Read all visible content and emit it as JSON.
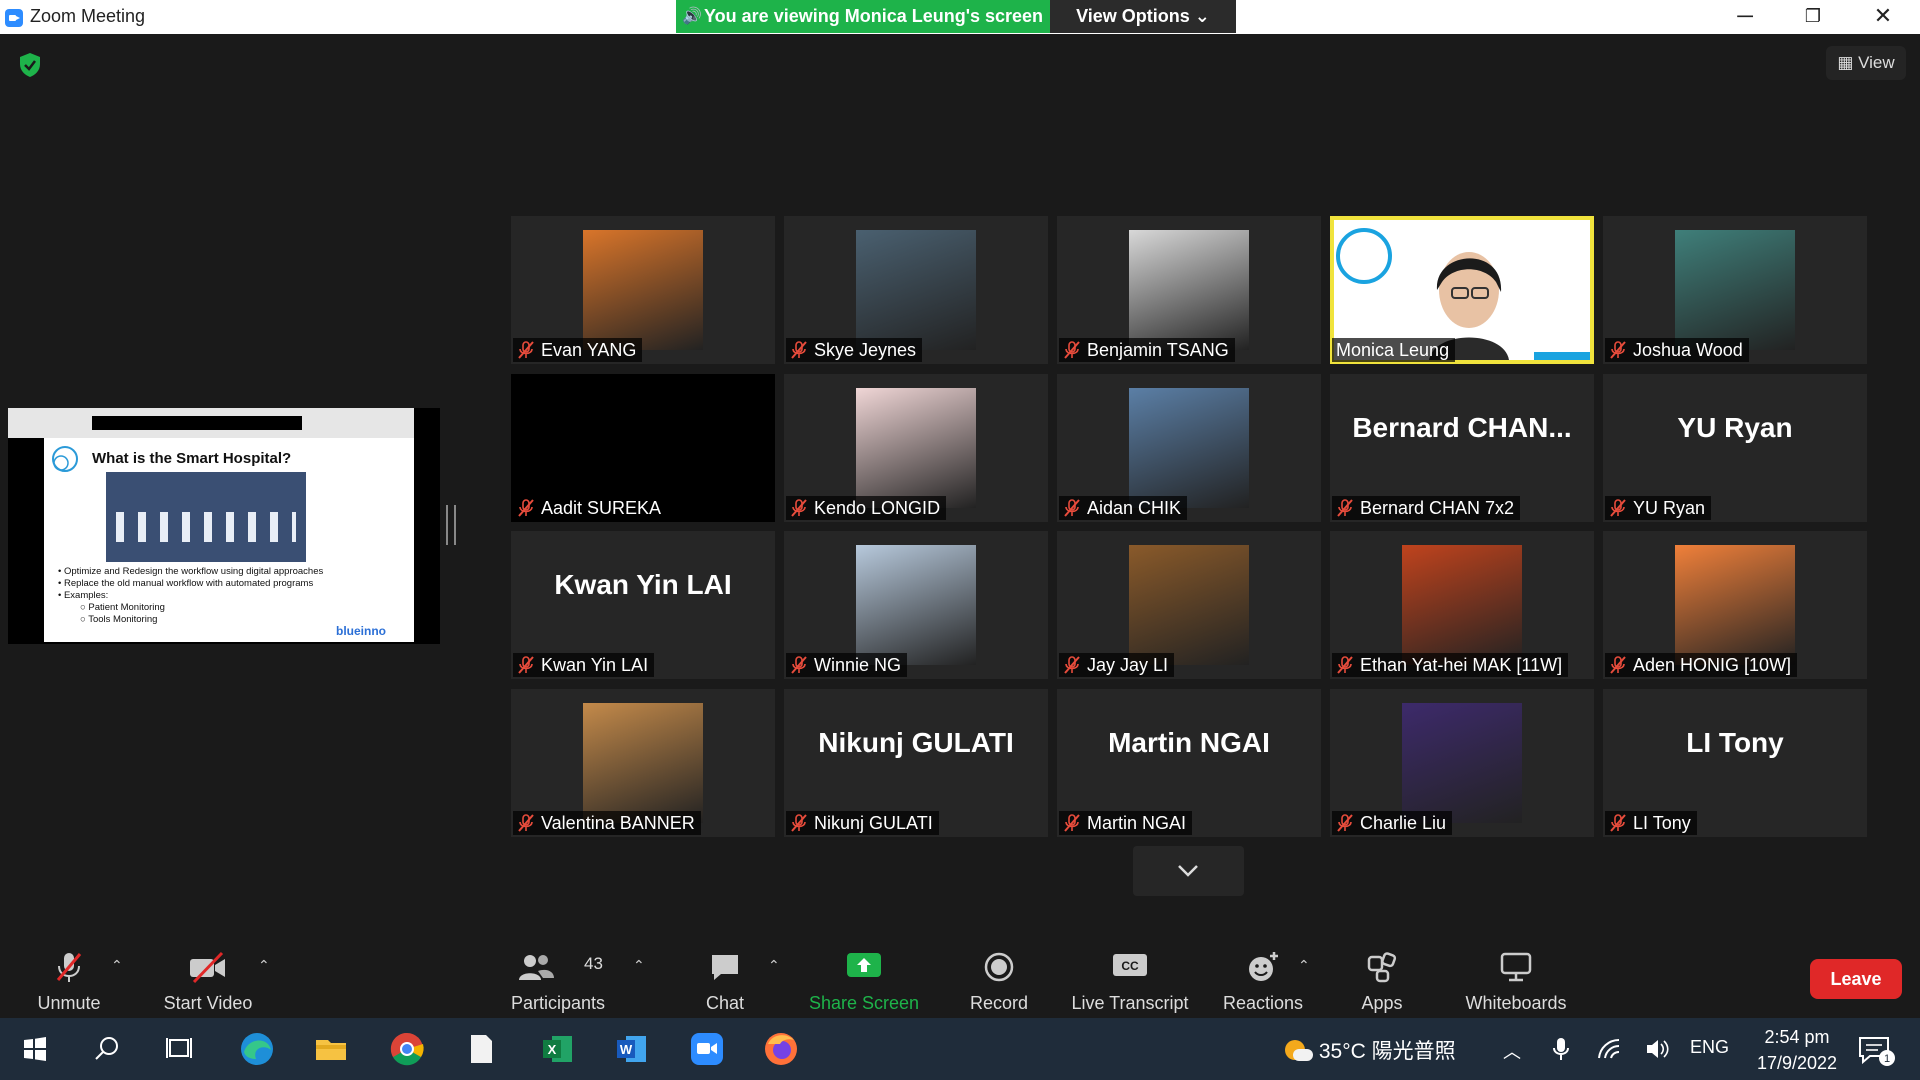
{
  "window": {
    "title": "Zoom Meeting",
    "banner": "You are viewing Monica Leung's screen",
    "view_options": "View Options",
    "minimize": "─",
    "restore": "❐",
    "close": "✕"
  },
  "view_button": "View",
  "shared_screen": {
    "slide_title": "What is the Smart Hospital?",
    "bullets": [
      "Optimize and Redesign the workflow using digital approaches",
      "Replace the old manual workflow with automated programs",
      "Examples:"
    ],
    "sub_bullets": [
      "Patient Monitoring",
      "Tools Monitoring"
    ],
    "logo": "blueinno"
  },
  "participants_grid": [
    {
      "name": "Evan YANG",
      "type": "photo",
      "color": "#d9752a"
    },
    {
      "name": "Skye Jeynes",
      "type": "photo",
      "color": "#4a6070"
    },
    {
      "name": "Benjamin TSANG",
      "type": "photo",
      "color": "#d8d8d8"
    },
    {
      "name": "Monica Leung",
      "type": "video",
      "color": "#ffffff"
    },
    {
      "name": "Joshua Wood",
      "type": "photo",
      "color": "#3f7f7a"
    },
    {
      "name": "Aadit SUREKA",
      "type": "black",
      "color": "#000000"
    },
    {
      "name": "Kendo LONGID",
      "type": "photo",
      "color": "#f0d6d6"
    },
    {
      "name": "Aidan CHIK",
      "type": "photo",
      "color": "#5b7fa6"
    },
    {
      "name": "Bernard CHAN 7x2",
      "type": "text",
      "display": "Bernard  CHAN..."
    },
    {
      "name": "YU Ryan",
      "type": "text",
      "display": "YU Ryan"
    },
    {
      "name": "Kwan Yin LAI",
      "type": "text",
      "display": "Kwan Yin LAI"
    },
    {
      "name": "Winnie NG",
      "type": "photo",
      "color": "#b7c9dc"
    },
    {
      "name": "Jay Jay LI",
      "type": "photo",
      "color": "#8a5a2a"
    },
    {
      "name": "Ethan Yat-hei MAK [11W]",
      "type": "photo",
      "color": "#c0431d"
    },
    {
      "name": "Aden HONIG [10W]",
      "type": "photo",
      "color": "#f0803a"
    },
    {
      "name": "Valentina BANNER",
      "type": "photo",
      "color": "#c48a4a"
    },
    {
      "name": "Nikunj GULATI",
      "type": "text",
      "display": "Nikunj GULATI"
    },
    {
      "name": "Martin NGAI",
      "type": "text",
      "display": "Martin NGAI"
    },
    {
      "name": "Charlie Liu",
      "type": "photo",
      "color": "#3d2a6b"
    },
    {
      "name": "LI Tony",
      "type": "text",
      "display": "LI Tony"
    }
  ],
  "toolbar": {
    "unmute": "Unmute",
    "start_video": "Start Video",
    "participants": "Participants",
    "participants_count": "43",
    "chat": "Chat",
    "share_screen": "Share Screen",
    "record": "Record",
    "live_transcript": "Live Transcript",
    "reactions": "Reactions",
    "apps": "Apps",
    "whiteboards": "Whiteboards",
    "leave": "Leave"
  },
  "taskbar": {
    "weather": "35°C 陽光普照",
    "language": "ENG",
    "time": "2:54 pm",
    "date": "17/9/2022",
    "notifications": "1"
  },
  "colors": {
    "accent_green": "#1eb34a",
    "leave_red": "#e02828",
    "active_speaker": "#f0e33c"
  }
}
